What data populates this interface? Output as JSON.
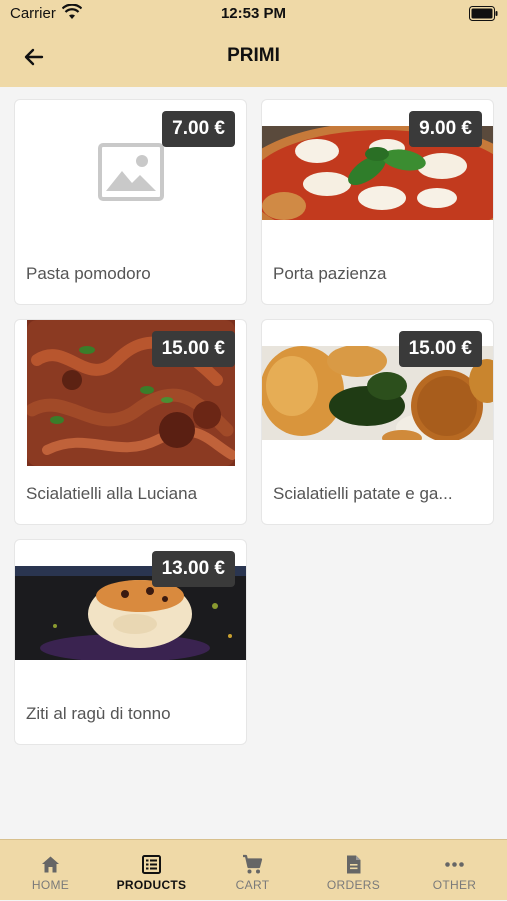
{
  "status": {
    "carrier": "Carrier",
    "time": "12:53 PM"
  },
  "header": {
    "title": "PRIMI"
  },
  "products": [
    {
      "name": "Pasta pomodoro",
      "price": "7.00 €",
      "image": "image-placeholder-icon"
    },
    {
      "name": "Porta pazienza",
      "price": "9.00 €",
      "image": "pizza-photo"
    },
    {
      "name": "Scialatielli alla Luciana",
      "price": "15.00 €",
      "image": "octopus-pasta-photo"
    },
    {
      "name": "Scialatielli patate e ga...",
      "price": "15.00 €",
      "image": "fried-snacks-photo"
    },
    {
      "name": "Ziti al ragù di tonno",
      "price": "13.00 €",
      "image": "ziti-photo"
    }
  ],
  "tabs": [
    {
      "label": "HOME",
      "icon": "home-icon",
      "active": false
    },
    {
      "label": "PRODUCTS",
      "icon": "list-icon",
      "active": true
    },
    {
      "label": "CART",
      "icon": "cart-icon",
      "active": false
    },
    {
      "label": "ORDERS",
      "icon": "document-icon",
      "active": false
    },
    {
      "label": "OTHER",
      "icon": "more-icon",
      "active": false
    }
  ],
  "colors": {
    "bar": "#efd9a7",
    "price_badge": "#3a3a3a",
    "background": "#f4f4f4"
  }
}
